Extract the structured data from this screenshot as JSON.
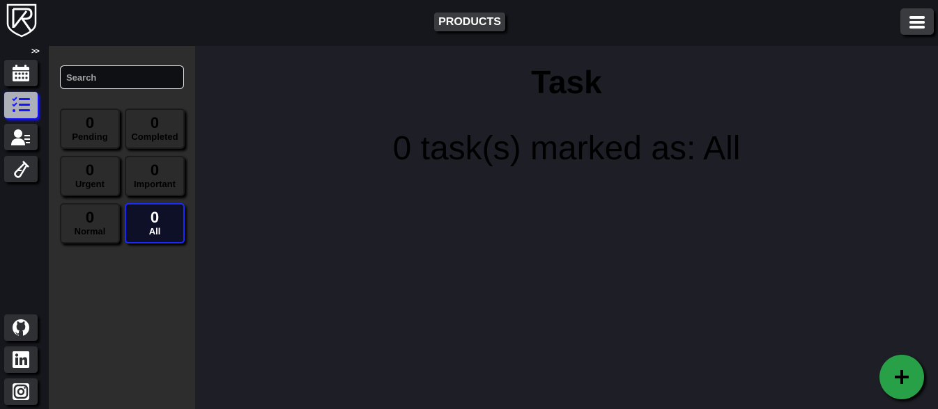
{
  "header": {
    "products_label": "PRODUCTS"
  },
  "nav": {
    "expand_label": ">>",
    "items": [
      {
        "icon": "calendar-icon"
      },
      {
        "icon": "task-list-icon",
        "active": true
      },
      {
        "icon": "contacts-icon"
      },
      {
        "icon": "test-tube-icon"
      }
    ],
    "social": [
      {
        "icon": "github-icon"
      },
      {
        "icon": "linkedin-icon"
      },
      {
        "icon": "instagram-icon"
      }
    ]
  },
  "filters": {
    "search_placeholder": "Search",
    "cards": [
      {
        "count": "0",
        "label": "Pending"
      },
      {
        "count": "0",
        "label": "Completed"
      },
      {
        "count": "0",
        "label": "Urgent"
      },
      {
        "count": "0",
        "label": "Important"
      },
      {
        "count": "0",
        "label": "Normal"
      },
      {
        "count": "0",
        "label": "All",
        "selected": true
      }
    ]
  },
  "main": {
    "title": "Task",
    "summary": "0 task(s) marked as: All"
  },
  "colors": {
    "active_accent": "#1a2aff",
    "fab": "#27a048"
  }
}
